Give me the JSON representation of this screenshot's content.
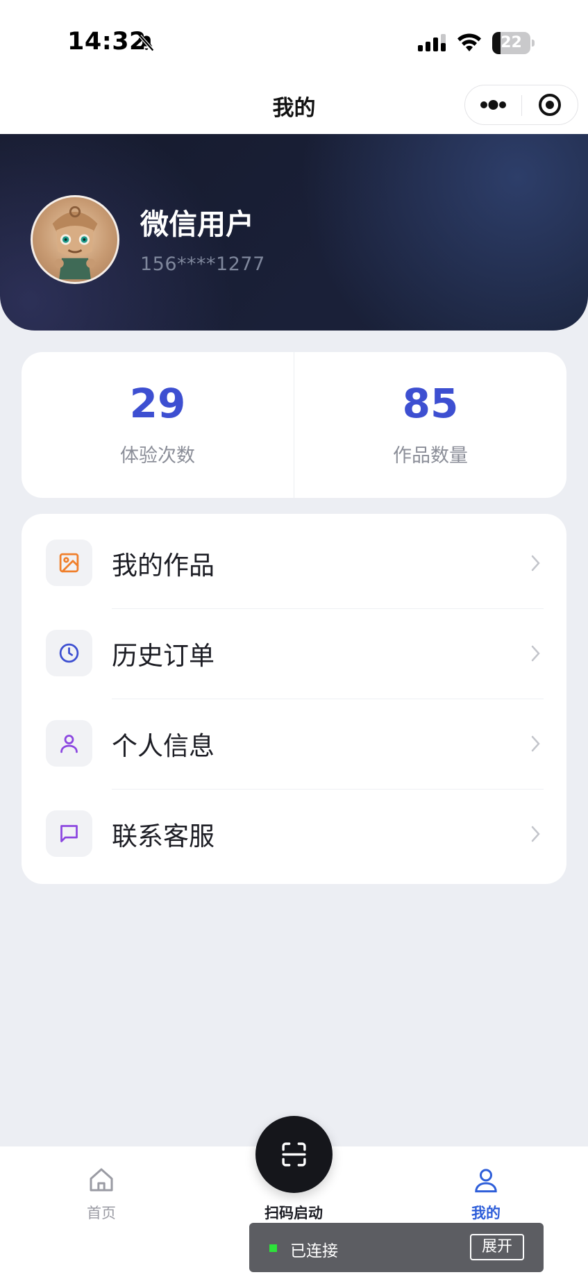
{
  "status_bar": {
    "time": "14:32",
    "battery": "22",
    "battery_level": 0.22,
    "icons": [
      "bell-slash-icon",
      "signal-icon",
      "wifi-icon",
      "battery-icon"
    ]
  },
  "nav": {
    "title": "我的",
    "capsule_icons": [
      "more-dots-icon",
      "close-target-icon"
    ]
  },
  "profile": {
    "name": "微信用户",
    "phone": "156****1277"
  },
  "stats": [
    {
      "value": "29",
      "label": "体验次数"
    },
    {
      "value": "85",
      "label": "作品数量"
    }
  ],
  "menu": [
    {
      "label": "我的作品",
      "icon": "image-icon",
      "color": "#f07f2b"
    },
    {
      "label": "历史订单",
      "icon": "clock-icon",
      "color": "#3d4fd1"
    },
    {
      "label": "个人信息",
      "icon": "user-icon",
      "color": "#8b46e0"
    },
    {
      "label": "联系客服",
      "icon": "message-icon",
      "color": "#8b46e0"
    }
  ],
  "tabbar": {
    "home_label": "首页",
    "scan_label": "扫码启动",
    "mine_label": "我的",
    "active_tab": "mine",
    "active_color": "#2e5ed9",
    "inactive_color": "#9a9ba3"
  },
  "connection": {
    "status": "已连接",
    "expand_label": "展开",
    "indicator_color": "#2de23a"
  },
  "colors": {
    "accent": "#3d4fd1",
    "header_dark": "#161b2e"
  }
}
